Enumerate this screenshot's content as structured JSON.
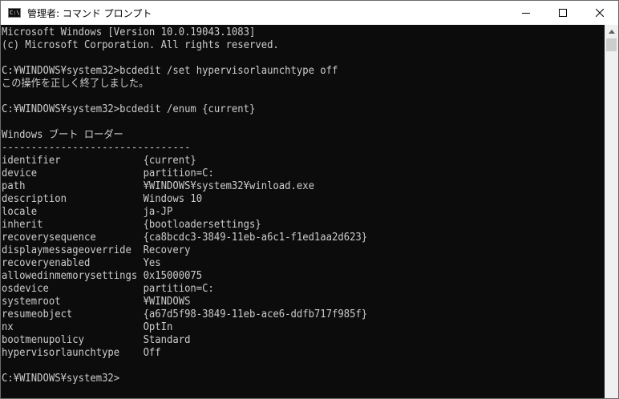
{
  "window": {
    "title": "管理者: コマンド プロンプト",
    "icon_text": "C:\\",
    "icons": {
      "app": "command-prompt-icon",
      "minimize": "minimize-icon",
      "maximize": "maximize-icon",
      "close": "close-icon",
      "scroll_up": "scroll-up-arrow-icon"
    }
  },
  "console": {
    "lines": [
      "Microsoft Windows [Version 10.0.19043.1083]",
      "(c) Microsoft Corporation. All rights reserved.",
      "",
      "C:¥WINDOWS¥system32>bcdedit /set hypervisorlaunchtype off",
      "この操作を正しく終了しました。",
      "",
      "C:¥WINDOWS¥system32>bcdedit /enum {current}",
      "",
      "Windows ブート ローダー",
      "--------------------------------",
      "identifier              {current}",
      "device                  partition=C:",
      "path                    ¥WINDOWS¥system32¥winload.exe",
      "description             Windows 10",
      "locale                  ja-JP",
      "inherit                 {bootloadersettings}",
      "recoverysequence        {ca8bcdc3-3849-11eb-a6c1-f1ed1aa2d623}",
      "displaymessageoverride  Recovery",
      "recoveryenabled         Yes",
      "allowedinmemorysettings 0x15000075",
      "osdevice                partition=C:",
      "systemroot              ¥WINDOWS",
      "resumeobject            {a67d5f98-3849-11eb-ace6-ddfb717f985f}",
      "nx                      OptIn",
      "bootmenupolicy          Standard",
      "hypervisorlaunchtype    Off",
      "",
      "C:¥WINDOWS¥system32>"
    ]
  }
}
